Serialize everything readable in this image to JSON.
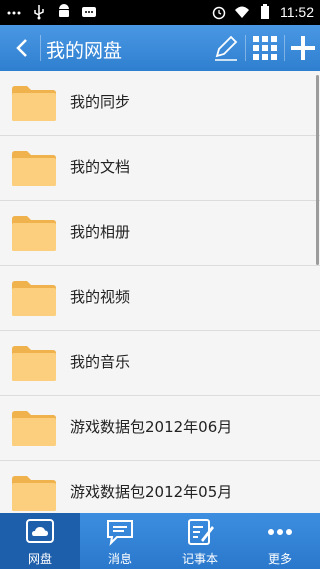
{
  "status_bar": {
    "time": "11:52",
    "left_icons": [
      "more-dots-icon",
      "usb-icon",
      "android-icon",
      "message-icon"
    ],
    "right_icons": [
      "alarm-icon",
      "wifi-icon",
      "battery-icon"
    ]
  },
  "header": {
    "title": "我的网盘",
    "back_icon": "chevron-left-icon",
    "actions": [
      "edit-icon",
      "grid-icon",
      "add-icon"
    ]
  },
  "folders": [
    {
      "label": "我的同步"
    },
    {
      "label": "我的文档"
    },
    {
      "label": "我的相册"
    },
    {
      "label": "我的视频"
    },
    {
      "label": "我的音乐"
    },
    {
      "label": "游戏数据包2012年06月"
    },
    {
      "label": "游戏数据包2012年05月"
    }
  ],
  "bottom_nav": [
    {
      "label": "网盘",
      "icon": "cloud-icon",
      "active": true
    },
    {
      "label": "消息",
      "icon": "chat-icon",
      "active": false
    },
    {
      "label": "记事本",
      "icon": "notepad-icon",
      "active": false
    },
    {
      "label": "更多",
      "icon": "more-icon",
      "active": false
    }
  ],
  "colors": {
    "header_blue": "#3b8ce0",
    "folder_yellow": "#f7c46a",
    "nav_active": "#1e5fab"
  }
}
